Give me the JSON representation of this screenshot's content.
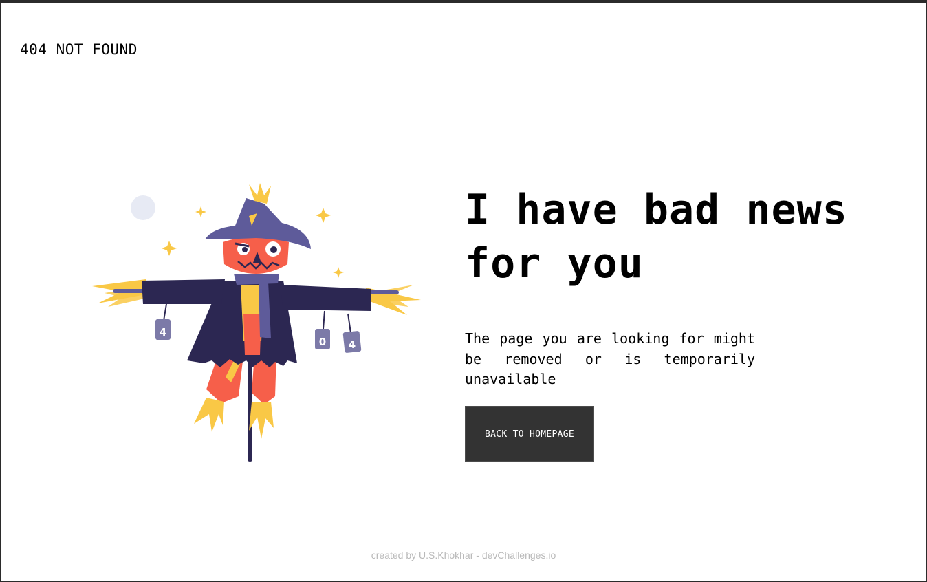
{
  "header": {
    "brand": "404 NOT FOUND"
  },
  "main": {
    "headline": "I have bad news for you",
    "message": "The page you are looking for might be removed or is temporarily unavailable",
    "button_label": "BACK TO HOMEPAGE"
  },
  "illustration": {
    "can_labels": [
      "4",
      "0",
      "4"
    ],
    "colors": {
      "coat": "#2c2752",
      "hat": "#5e5b9a",
      "face": "#f65f4a",
      "straw": "#f9c846",
      "can": "#7c7aa8",
      "moon": "#e7eaf4"
    }
  },
  "footer": {
    "credit": "created by U.S.Khokhar - devChallenges.io"
  }
}
